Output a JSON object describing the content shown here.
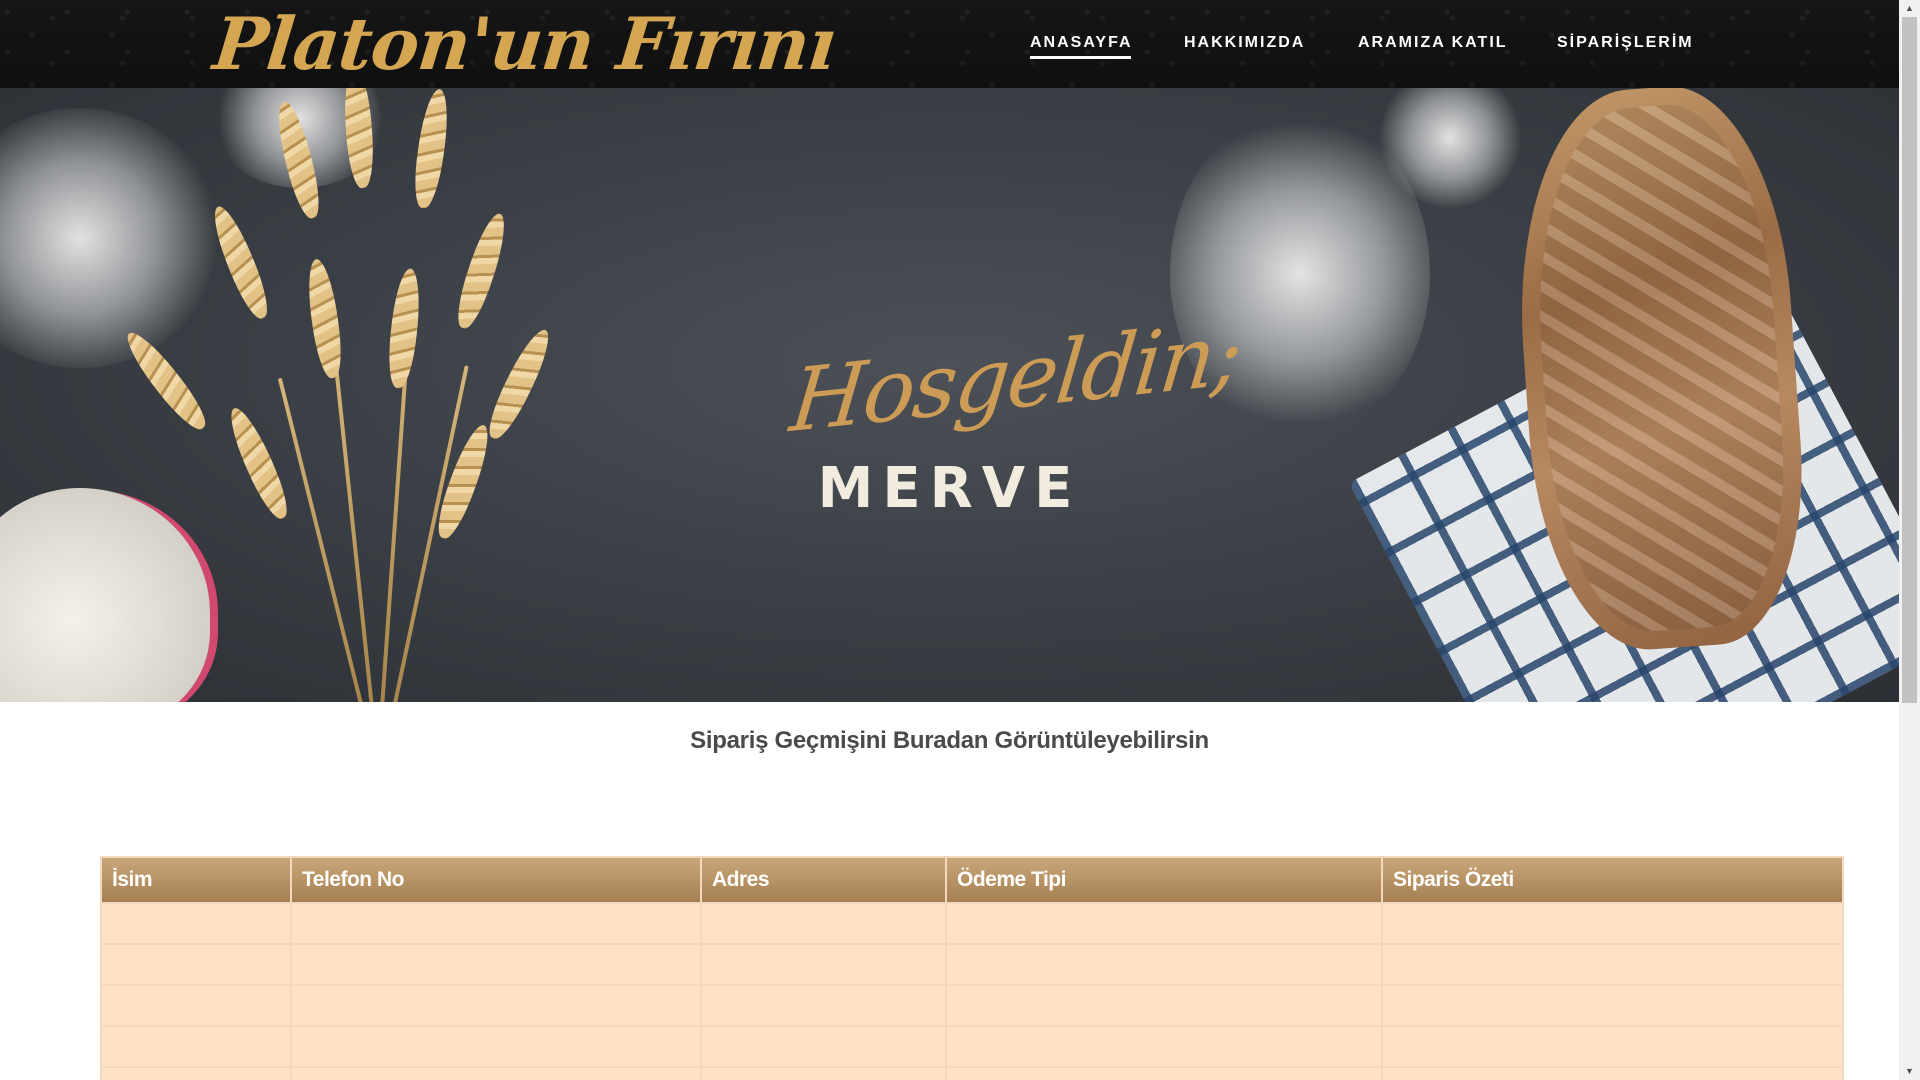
{
  "brand": {
    "logo_text": "Platon'un Fırını"
  },
  "nav": {
    "items": [
      {
        "label": "ANASAYFA",
        "active": true
      },
      {
        "label": "HAKKIMIZDA",
        "active": false
      },
      {
        "label": "ARAMIZA KATIL",
        "active": false
      },
      {
        "label": "SİPARİŞLERİM",
        "active": false
      }
    ]
  },
  "hero": {
    "greeting": "Hosgeldin;",
    "name": "MERVE"
  },
  "orders": {
    "title": "Sipariş Geçmişini Buradan Görüntüleyebilirsin",
    "columns": [
      "İsim",
      "Telefon No",
      "Adres",
      "Ödeme Tipi",
      "Siparis Özeti"
    ],
    "rows": [
      [
        "",
        "",
        "",
        "",
        ""
      ],
      [
        "",
        "",
        "",
        "",
        ""
      ],
      [
        "",
        "",
        "",
        "",
        ""
      ],
      [
        "",
        "",
        "",
        "",
        ""
      ],
      [
        "",
        "",
        "",
        "",
        ""
      ]
    ]
  },
  "colors": {
    "accent_gold": "#d5a652",
    "header_brown": "#b38d5f",
    "row_peach": "#fde2c6",
    "nav_bg": "#121212"
  },
  "icons": {
    "scroll_up": "chevron-up-icon",
    "scroll_down": "chevron-down-icon"
  }
}
